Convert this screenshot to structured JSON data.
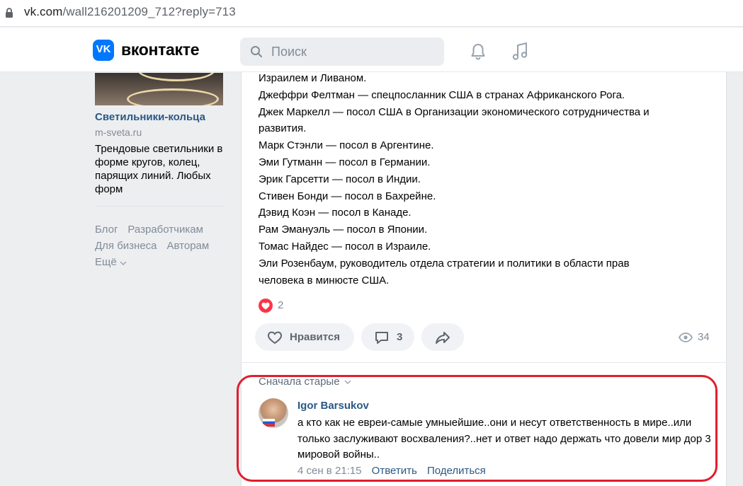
{
  "browser": {
    "url_host": "vk.com",
    "url_path": "/wall216201209_712?reply=713"
  },
  "header": {
    "logo_text": "VK",
    "brand": "вконтакте",
    "search_placeholder": "Поиск",
    "accent": "#0077ff"
  },
  "sidebar_ad": {
    "title": "Светильники-кольца",
    "domain": "m-sveta.ru",
    "description": "Трендовые светильники в форме кругов, колец, парящих линий. Любых форм"
  },
  "footer_links": {
    "blog": "Блог",
    "developers": "Разработчикам",
    "business": "Для бизнеса",
    "authors": "Авторам",
    "more": "Ещё"
  },
  "post": {
    "lines": [
      "Израилем и Ливаном.",
      "Джеффри Фелтман — спецпосланник США в странах Африканского Рога.",
      "Джек Маркелл — посол США в Организации экономического сотрудничества и",
      "развития.",
      "Марк Стэнли — посол в Аргентине.",
      "Эми Гутманн — посол в Германии.",
      "Эрик Гарсетти — посол в Индии.",
      "Стивен Бонди — посол в Бахрейне.",
      "Дэвид Коэн — посол в Канаде.",
      "Рам Эмануэль — посол в Японии.",
      "Томас Найдес — посол в Израиле.",
      "Эли Розенбаум, руководитель отдела стратегии и политики в области прав",
      "человека в минюсте США."
    ],
    "reactions_count": "2",
    "like_label": "Нравится",
    "comments_count": "3",
    "views_count": "34"
  },
  "comments": {
    "sort_label": "Сначала старые",
    "items": [
      {
        "author": "Igor Barsukov",
        "text": "а кто как не евреи-самые умныейшие..они и несут ответственность в мире..или только заслуживают восхваления?..нет и ответ надо держать что довели мир дор 3 мировой войны..",
        "time": "4 сен в 21:15",
        "reply_label": "Ответить",
        "share_label": "Поделиться"
      }
    ]
  },
  "highlight_color": "#e01e2d"
}
